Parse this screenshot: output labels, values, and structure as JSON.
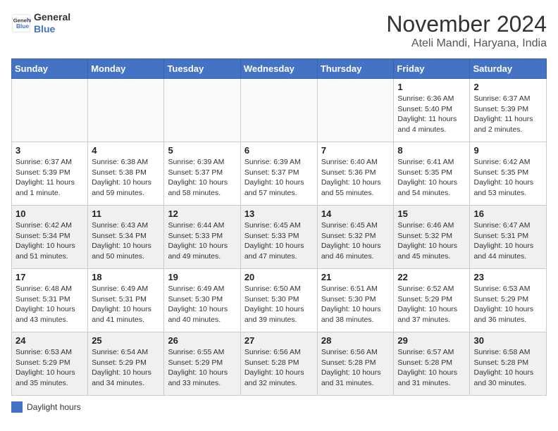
{
  "header": {
    "logo_line1": "General",
    "logo_line2": "Blue",
    "month_title": "November 2024",
    "subtitle": "Ateli Mandi, Haryana, India"
  },
  "footer": {
    "legend_label": "Daylight hours"
  },
  "calendar": {
    "weekdays": [
      "Sunday",
      "Monday",
      "Tuesday",
      "Wednesday",
      "Thursday",
      "Friday",
      "Saturday"
    ],
    "weeks": [
      [
        {
          "day": "",
          "info": ""
        },
        {
          "day": "",
          "info": ""
        },
        {
          "day": "",
          "info": ""
        },
        {
          "day": "",
          "info": ""
        },
        {
          "day": "",
          "info": ""
        },
        {
          "day": "1",
          "info": "Sunrise: 6:36 AM\nSunset: 5:40 PM\nDaylight: 11 hours and 4 minutes."
        },
        {
          "day": "2",
          "info": "Sunrise: 6:37 AM\nSunset: 5:39 PM\nDaylight: 11 hours and 2 minutes."
        }
      ],
      [
        {
          "day": "3",
          "info": "Sunrise: 6:37 AM\nSunset: 5:39 PM\nDaylight: 11 hours and 1 minute."
        },
        {
          "day": "4",
          "info": "Sunrise: 6:38 AM\nSunset: 5:38 PM\nDaylight: 10 hours and 59 minutes."
        },
        {
          "day": "5",
          "info": "Sunrise: 6:39 AM\nSunset: 5:37 PM\nDaylight: 10 hours and 58 minutes."
        },
        {
          "day": "6",
          "info": "Sunrise: 6:39 AM\nSunset: 5:37 PM\nDaylight: 10 hours and 57 minutes."
        },
        {
          "day": "7",
          "info": "Sunrise: 6:40 AM\nSunset: 5:36 PM\nDaylight: 10 hours and 55 minutes."
        },
        {
          "day": "8",
          "info": "Sunrise: 6:41 AM\nSunset: 5:35 PM\nDaylight: 10 hours and 54 minutes."
        },
        {
          "day": "9",
          "info": "Sunrise: 6:42 AM\nSunset: 5:35 PM\nDaylight: 10 hours and 53 minutes."
        }
      ],
      [
        {
          "day": "10",
          "info": "Sunrise: 6:42 AM\nSunset: 5:34 PM\nDaylight: 10 hours and 51 minutes."
        },
        {
          "day": "11",
          "info": "Sunrise: 6:43 AM\nSunset: 5:34 PM\nDaylight: 10 hours and 50 minutes."
        },
        {
          "day": "12",
          "info": "Sunrise: 6:44 AM\nSunset: 5:33 PM\nDaylight: 10 hours and 49 minutes."
        },
        {
          "day": "13",
          "info": "Sunrise: 6:45 AM\nSunset: 5:33 PM\nDaylight: 10 hours and 47 minutes."
        },
        {
          "day": "14",
          "info": "Sunrise: 6:45 AM\nSunset: 5:32 PM\nDaylight: 10 hours and 46 minutes."
        },
        {
          "day": "15",
          "info": "Sunrise: 6:46 AM\nSunset: 5:32 PM\nDaylight: 10 hours and 45 minutes."
        },
        {
          "day": "16",
          "info": "Sunrise: 6:47 AM\nSunset: 5:31 PM\nDaylight: 10 hours and 44 minutes."
        }
      ],
      [
        {
          "day": "17",
          "info": "Sunrise: 6:48 AM\nSunset: 5:31 PM\nDaylight: 10 hours and 43 minutes."
        },
        {
          "day": "18",
          "info": "Sunrise: 6:49 AM\nSunset: 5:31 PM\nDaylight: 10 hours and 41 minutes."
        },
        {
          "day": "19",
          "info": "Sunrise: 6:49 AM\nSunset: 5:30 PM\nDaylight: 10 hours and 40 minutes."
        },
        {
          "day": "20",
          "info": "Sunrise: 6:50 AM\nSunset: 5:30 PM\nDaylight: 10 hours and 39 minutes."
        },
        {
          "day": "21",
          "info": "Sunrise: 6:51 AM\nSunset: 5:30 PM\nDaylight: 10 hours and 38 minutes."
        },
        {
          "day": "22",
          "info": "Sunrise: 6:52 AM\nSunset: 5:29 PM\nDaylight: 10 hours and 37 minutes."
        },
        {
          "day": "23",
          "info": "Sunrise: 6:53 AM\nSunset: 5:29 PM\nDaylight: 10 hours and 36 minutes."
        }
      ],
      [
        {
          "day": "24",
          "info": "Sunrise: 6:53 AM\nSunset: 5:29 PM\nDaylight: 10 hours and 35 minutes."
        },
        {
          "day": "25",
          "info": "Sunrise: 6:54 AM\nSunset: 5:29 PM\nDaylight: 10 hours and 34 minutes."
        },
        {
          "day": "26",
          "info": "Sunrise: 6:55 AM\nSunset: 5:29 PM\nDaylight: 10 hours and 33 minutes."
        },
        {
          "day": "27",
          "info": "Sunrise: 6:56 AM\nSunset: 5:28 PM\nDaylight: 10 hours and 32 minutes."
        },
        {
          "day": "28",
          "info": "Sunrise: 6:56 AM\nSunset: 5:28 PM\nDaylight: 10 hours and 31 minutes."
        },
        {
          "day": "29",
          "info": "Sunrise: 6:57 AM\nSunset: 5:28 PM\nDaylight: 10 hours and 31 minutes."
        },
        {
          "day": "30",
          "info": "Sunrise: 6:58 AM\nSunset: 5:28 PM\nDaylight: 10 hours and 30 minutes."
        }
      ]
    ]
  }
}
